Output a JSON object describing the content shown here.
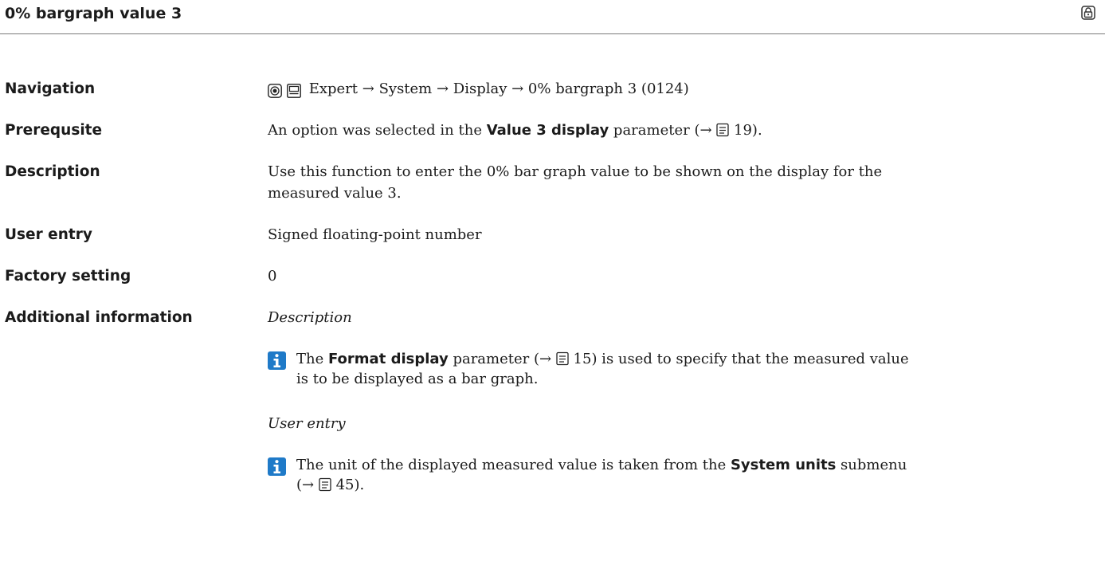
{
  "header": {
    "title": "0% bargraph value 3"
  },
  "navigation": {
    "label": "Navigation",
    "icons": [
      "operation-icon",
      "display-icon"
    ],
    "path": "Expert → System → Display → 0% bargraph 3 (0124)"
  },
  "prerequisite": {
    "label": "Prerequsite",
    "pre": "An option was selected in the ",
    "param": "Value 3 display",
    "post": " parameter (→ ",
    "page": "19",
    "end": ")."
  },
  "description": {
    "label": "Description",
    "line1": "Use this function to enter the 0% bar graph value to be shown on the display for the",
    "line2": "measured value 3."
  },
  "user_entry": {
    "label": "User entry",
    "value": "Signed floating-point number"
  },
  "factory_setting": {
    "label": "Factory setting",
    "value": "0"
  },
  "additional_information": {
    "label": "Additional information",
    "sections": [
      {
        "heading": "Description",
        "pre": "The ",
        "param": "Format display",
        "post": " parameter (→ ",
        "page": "15",
        "rest": ") is used to specify that the measured value",
        "line2": "is to be displayed as a bar graph."
      },
      {
        "heading": "User entry",
        "pre": "The unit of the displayed measured value is taken from the ",
        "param": "System units",
        "post": " submenu",
        "line2_pre": "(→ ",
        "page": "45",
        "line2_end": ")."
      }
    ]
  }
}
